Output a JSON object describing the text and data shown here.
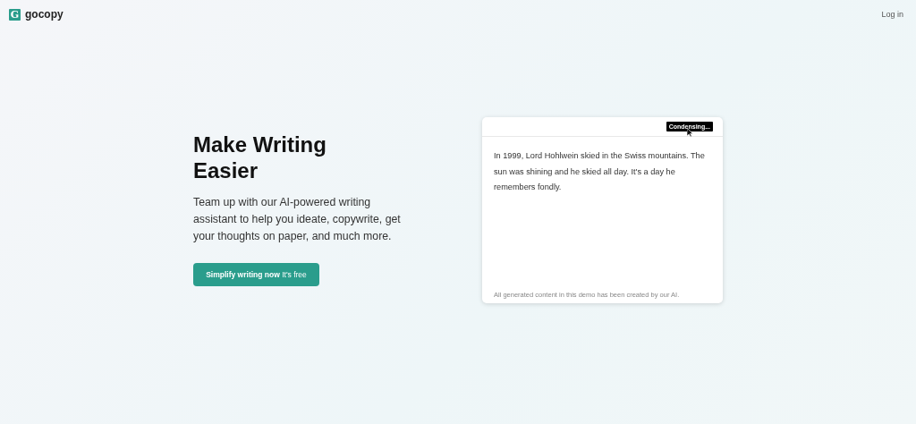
{
  "header": {
    "logo_letter": "G",
    "brand": "gocopy",
    "login": "Log in"
  },
  "hero": {
    "title": "Make Writing Easier",
    "subtitle": "Team up with our AI-powered writing assistant to help you ideate, copywrite, get your thoughts on paper, and much more.",
    "cta": "**Simplify writing now** It's free"
  },
  "demo": {
    "tooltip": "Condensing...",
    "text": "In 1999, Lord Hohlwein skied in the Swiss mountains. The sun was shining and he skied all day. It's a day he remembers fondly.",
    "footnote": "All generated content in this demo has been created by our AI."
  }
}
